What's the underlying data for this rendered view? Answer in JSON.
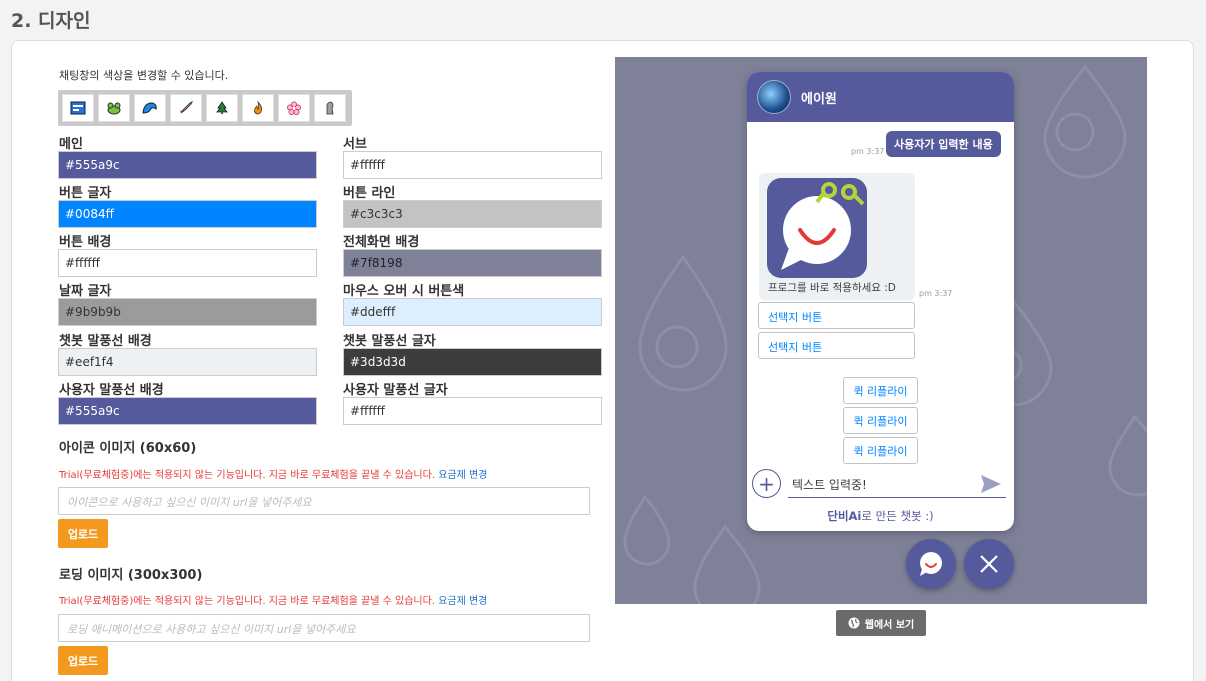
{
  "section": {
    "title": "2. 디자인"
  },
  "design": {
    "description": "채팅창의 색상을 변경할 수 있습니다.",
    "themes": [
      "space-icon",
      "frog-icon",
      "wave-icon",
      "rocket-icon",
      "tree-icon",
      "fire-icon",
      "flower-icon",
      "moai-icon"
    ]
  },
  "colors": {
    "main": {
      "label": "메인",
      "value": "#555a9c"
    },
    "sub": {
      "label": "서브",
      "value": "#ffffff"
    },
    "button_text": {
      "label": "버튼 글자",
      "value": "#0084ff"
    },
    "button_line": {
      "label": "버튼 라인",
      "value": "#c3c3c3"
    },
    "button_bg": {
      "label": "버튼 배경",
      "value": "#ffffff"
    },
    "fullscreen_bg": {
      "label": "전체화면 배경",
      "value": "#7f8198"
    },
    "date_text": {
      "label": "날짜 글자",
      "value": "#9b9b9b"
    },
    "hover_button": {
      "label": "마우스 오버 시 버튼색",
      "value": "#ddefff"
    },
    "bot_bubble_bg": {
      "label": "챗봇 말풍선 배경",
      "value": "#eef1f4"
    },
    "bot_bubble_text": {
      "label": "챗봇 말풍선 글자",
      "value": "#3d3d3d"
    },
    "user_bubble_bg": {
      "label": "사용자 말풍선 배경",
      "value": "#555a9c"
    },
    "user_bubble_text": {
      "label": "사용자 말풍선 글자",
      "value": "#ffffff"
    }
  },
  "icon_image": {
    "title": "아이콘 이미지 (60x60)",
    "trial_notice": "Trial(무료체험중)에는 적용되지 않는 기능입니다. 지금 바로 무료체험을 끝낼 수 있습니다.",
    "plan_link": "요금제 변경",
    "placeholder": "아이콘으로 사용하고 싶으신 이미지 url을 넣어주세요",
    "upload_label": "업로드"
  },
  "loading_image": {
    "title": "로딩 이미지 (300x300)",
    "trial_notice": "Trial(무료체험중)에는 적용되지 않는 기능입니다. 지금 바로 무료체험을 끝낼 수 있습니다.",
    "plan_link": "요금제 변경",
    "placeholder": "로딩 애니메이션으로 사용하고 싶으신 이미지 url을 넣어주세요",
    "upload_label": "업로드"
  },
  "preview": {
    "bot_name": "에이원",
    "user_message": "사용자가 입력한 내용",
    "user_time": "pm 3:37",
    "bot_message": "프로그를 바로 적용하세요 :D",
    "bot_time": "pm 3:37",
    "choices": [
      "선택지 버튼",
      "선택지 버튼"
    ],
    "quick_replies": [
      "퀵 리플라이",
      "퀵 리플라이",
      "퀵 리플라이"
    ],
    "input_text": "텍스트 입력중!",
    "powered_brand": "단비Ai",
    "powered_suffix": "로 만든 챗봇 :)",
    "web_view_label": "웹에서 보기"
  }
}
